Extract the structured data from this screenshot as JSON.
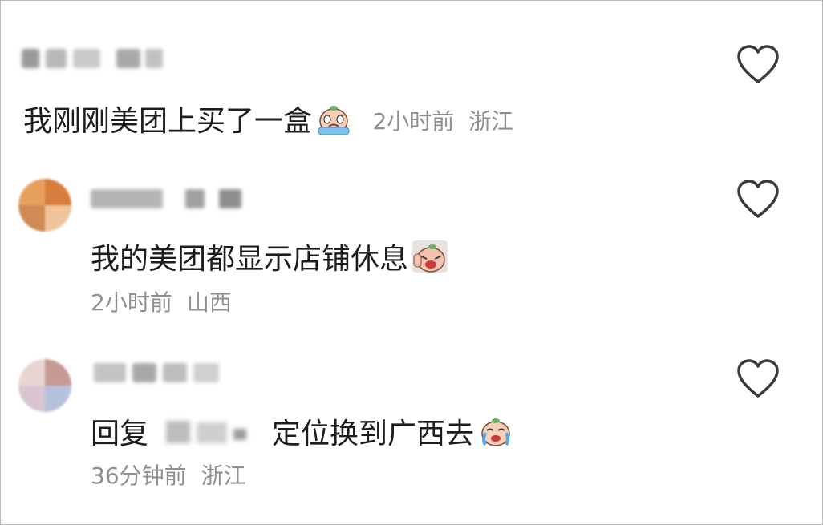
{
  "comments": [
    {
      "text": "我刚刚美团上买了一盒",
      "emoji": "crying-face-emoji",
      "time": "2小时前",
      "region": "浙江"
    },
    {
      "text": "我的美团都显示店铺休息",
      "emoji": "crying-face-emoji",
      "time": "2小时前",
      "region": "山西"
    },
    {
      "reply_label": "回复",
      "text": "定位换到广西去",
      "emoji": "crying-face-emoji",
      "time": "36分钟前",
      "region": "浙江"
    }
  ],
  "icons": {
    "like": "heart-outline-icon"
  },
  "colors": {
    "text": "#1d1d1d",
    "meta": "#8f8f8f",
    "heart_stroke": "#3a3a3a"
  }
}
